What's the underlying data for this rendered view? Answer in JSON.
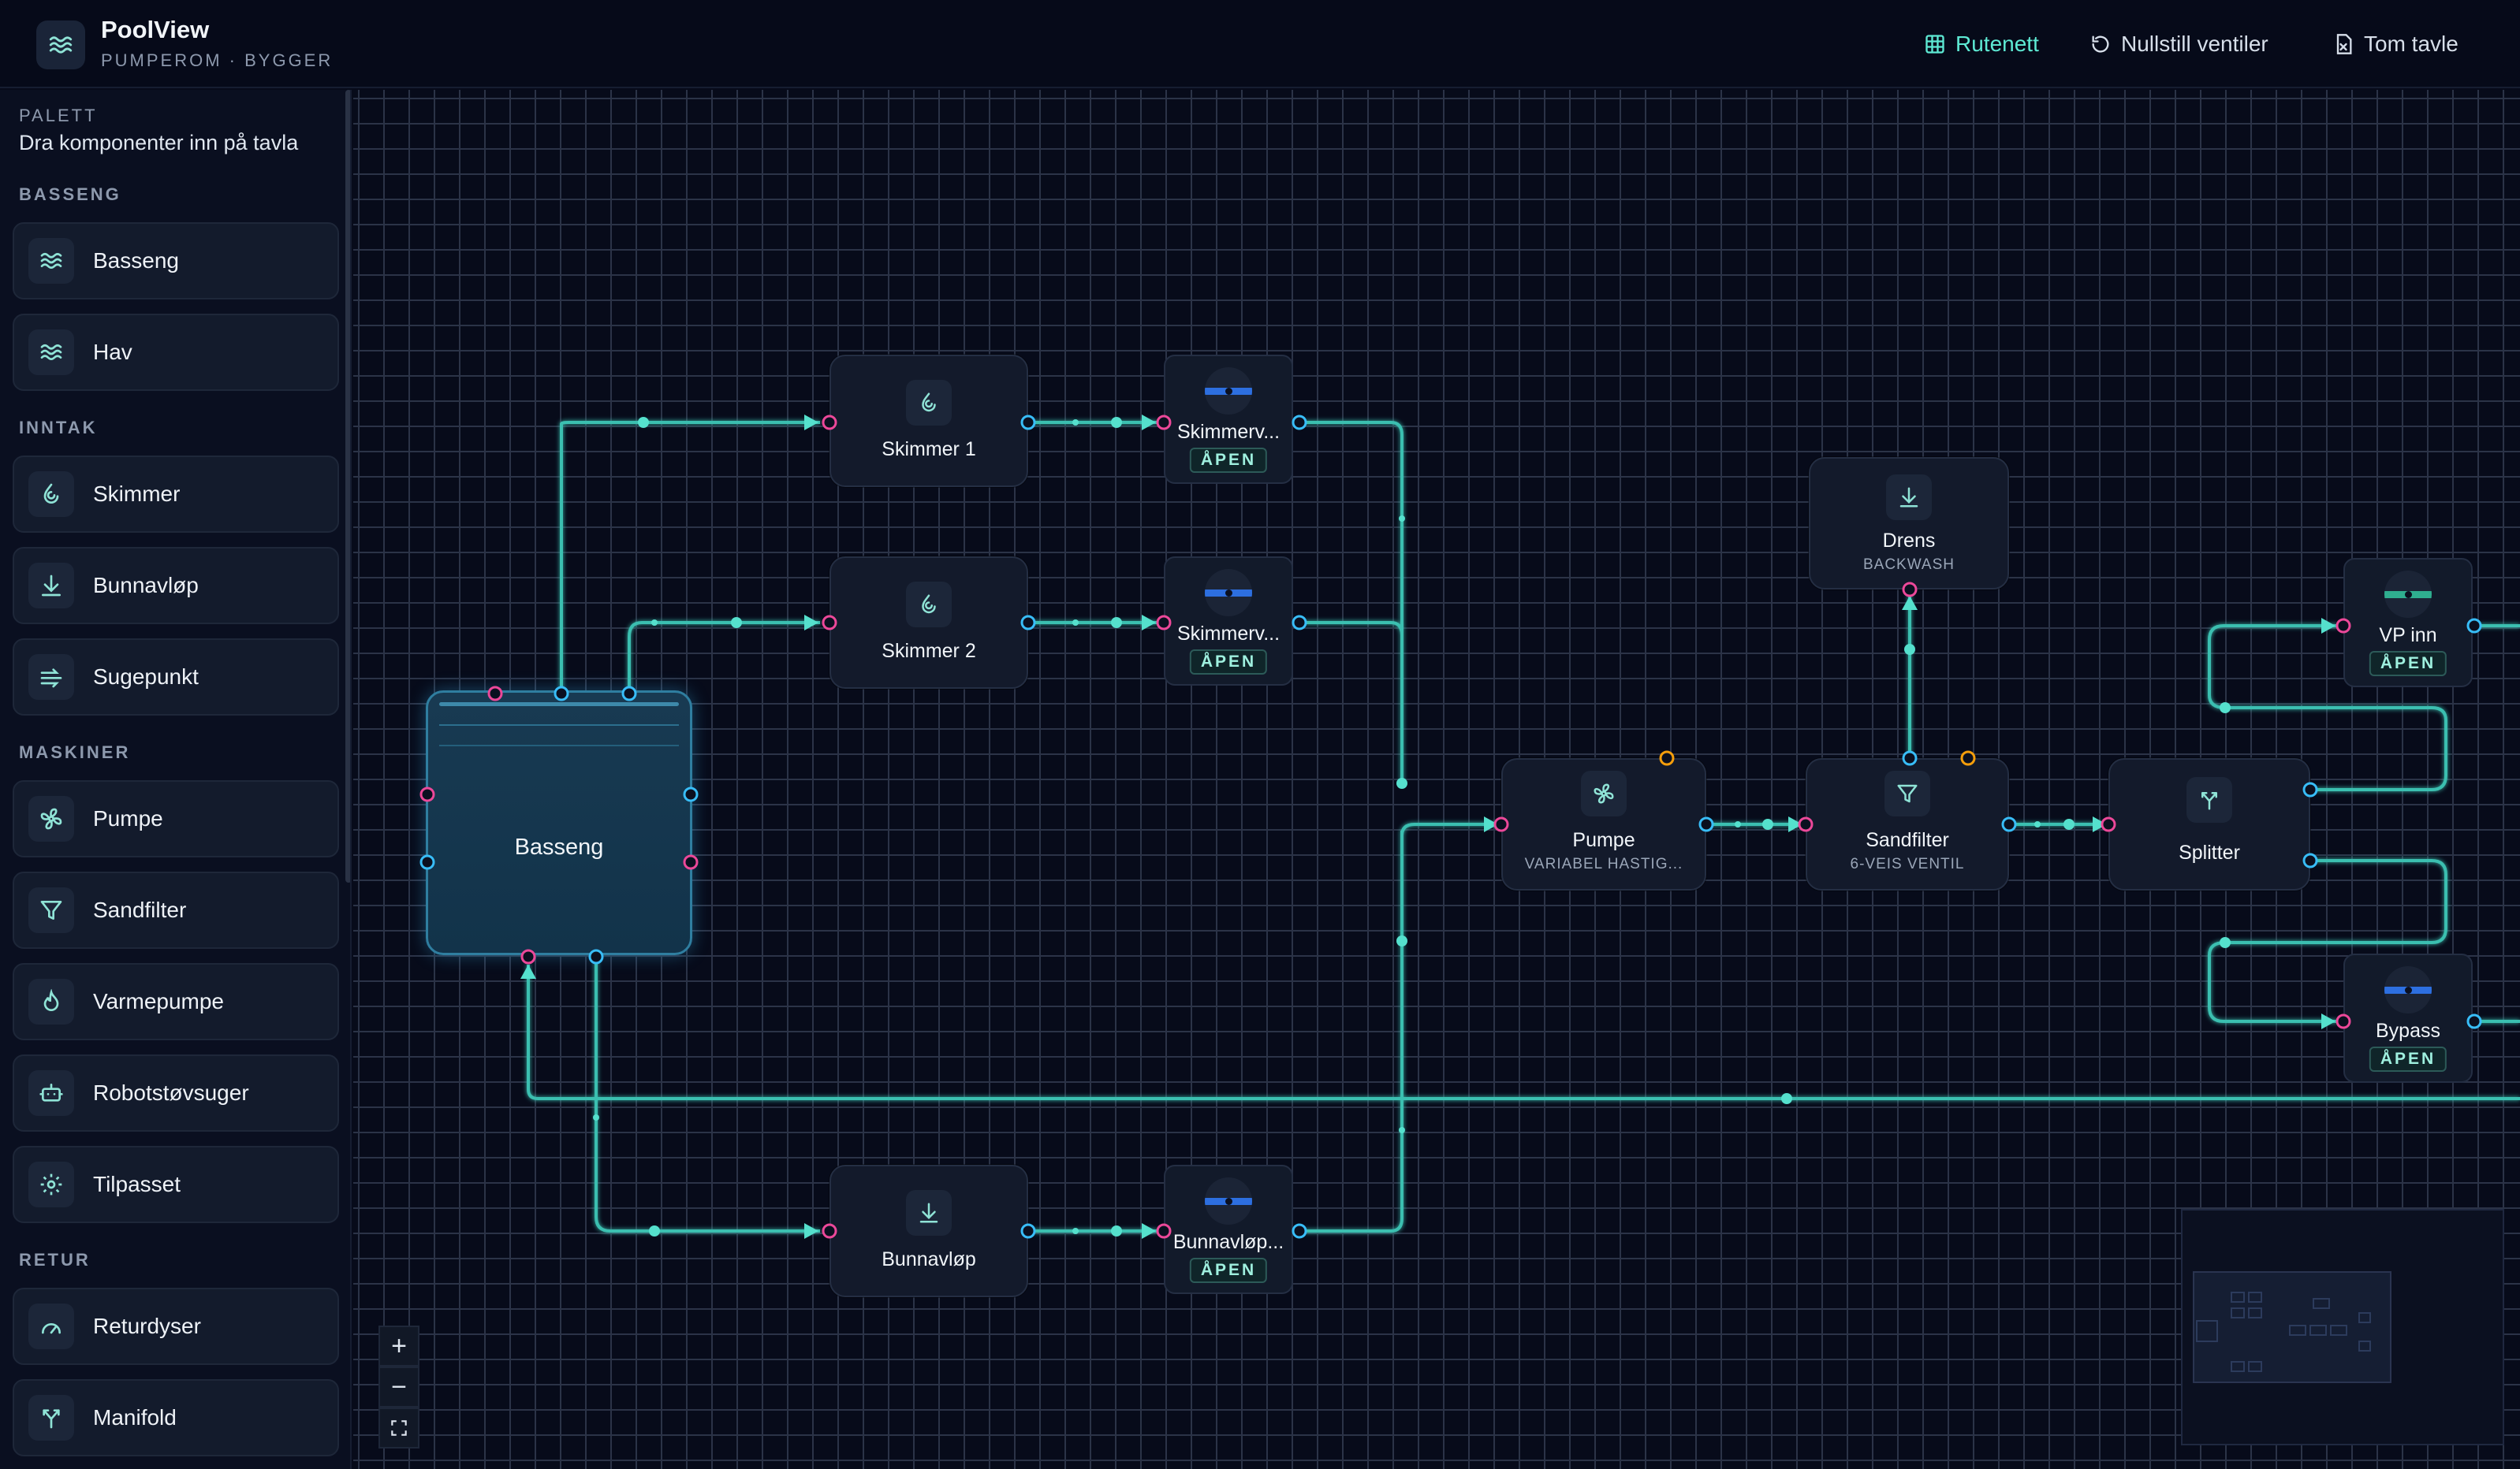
{
  "header": {
    "app_name": "PoolView",
    "subtitle": "PUMPEROM · BYGGER",
    "actions": [
      {
        "label": "Rutenett",
        "icon": "grid-icon",
        "active": true
      },
      {
        "label": "Nullstill ventiler",
        "icon": "reset-icon",
        "active": false
      },
      {
        "label": "Tom tavle",
        "icon": "clear-board-icon",
        "active": false
      }
    ]
  },
  "palette": {
    "title": "PALETT",
    "subtitle": "Dra komponenter inn på tavla",
    "sections": [
      {
        "title": "BASSENG",
        "items": [
          {
            "label": "Basseng",
            "icon": "waves-icon"
          },
          {
            "label": "Hav",
            "icon": "waves-icon"
          }
        ]
      },
      {
        "title": "INNTAK",
        "items": [
          {
            "label": "Skimmer",
            "icon": "droplet-swirl-icon"
          },
          {
            "label": "Bunnavløp",
            "icon": "arrow-down-icon"
          },
          {
            "label": "Sugepunkt",
            "icon": "suction-icon"
          }
        ]
      },
      {
        "title": "MASKINER",
        "items": [
          {
            "label": "Pumpe",
            "icon": "fan-icon"
          },
          {
            "label": "Sandfilter",
            "icon": "filter-icon"
          },
          {
            "label": "Varmepumpe",
            "icon": "flame-icon"
          },
          {
            "label": "Robotstøvsuger",
            "icon": "robot-icon"
          },
          {
            "label": "Tilpasset",
            "icon": "gear-icon"
          }
        ]
      },
      {
        "title": "RETUR",
        "items": [
          {
            "label": "Returdyser",
            "icon": "gauge-icon"
          },
          {
            "label": "Manifold",
            "icon": "fork-icon"
          }
        ]
      }
    ]
  },
  "canvas": {
    "basin": {
      "title": "Basseng"
    },
    "nodes": [
      {
        "id": "skimmer1",
        "title": "Skimmer 1",
        "subtitle": "",
        "icon": "droplet-swirl-icon"
      },
      {
        "id": "skimmer2",
        "title": "Skimmer 2",
        "subtitle": "",
        "icon": "droplet-swirl-icon"
      },
      {
        "id": "bunnavlop",
        "title": "Bunnavløp",
        "subtitle": "",
        "icon": "arrow-down-icon"
      },
      {
        "id": "drens",
        "title": "Drens",
        "subtitle": "BACKWASH",
        "icon": "arrow-down-icon"
      },
      {
        "id": "pumpe",
        "title": "Pumpe",
        "subtitle": "VARIABEL HASTIG...",
        "icon": "fan-icon"
      },
      {
        "id": "sandfilter",
        "title": "Sandfilter",
        "subtitle": "6-VEIS VENTIL",
        "icon": "filter-icon"
      },
      {
        "id": "splitter",
        "title": "Splitter",
        "subtitle": "",
        "icon": "fork-icon"
      }
    ],
    "valves": [
      {
        "id": "v1",
        "title": "Skimmerv...",
        "state": "ÅPEN",
        "color": "#2d6fe0"
      },
      {
        "id": "v2",
        "title": "Skimmerv...",
        "state": "ÅPEN",
        "color": "#2d6fe0"
      },
      {
        "id": "v3",
        "title": "Bunnavløp...",
        "state": "ÅPEN",
        "color": "#2d6fe0"
      },
      {
        "id": "v4",
        "title": "VP inn",
        "state": "ÅPEN",
        "color": "#2fae8f"
      },
      {
        "id": "v5",
        "title": "Bypass",
        "state": "ÅPEN",
        "color": "#2d6fe0"
      }
    ],
    "zoom": {
      "in": "+",
      "out": "−",
      "fit": "⛶"
    }
  },
  "colors": {
    "accent": "#5eead4",
    "wire": "#4fd1c5",
    "port_in": "#ec4899",
    "port_out": "#38bdf8",
    "port_warn": "#f59e0b",
    "background": "#070b1a"
  }
}
